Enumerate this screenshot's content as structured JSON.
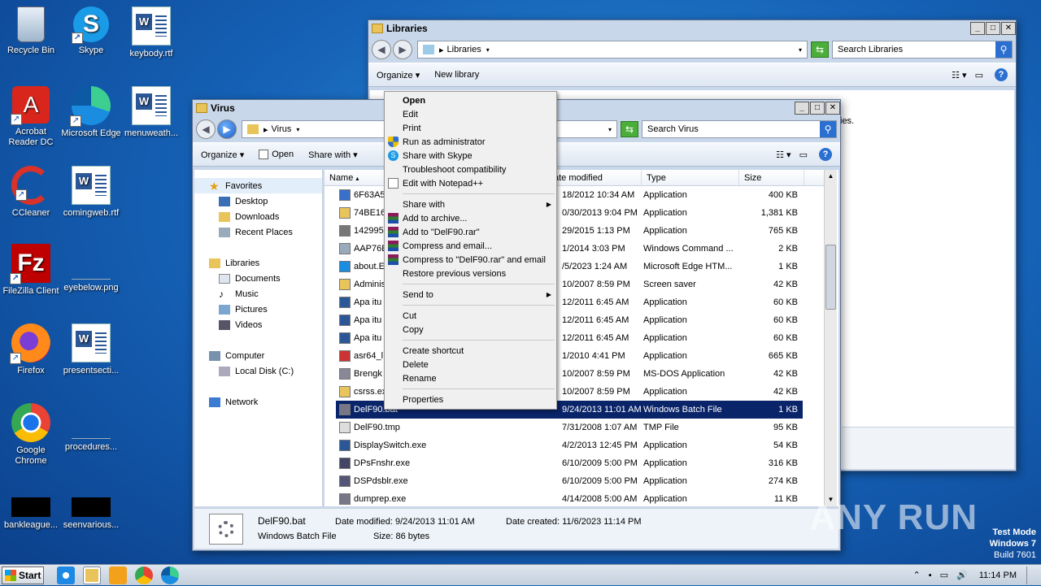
{
  "desktop_icons": [
    {
      "label": "Recycle Bin"
    },
    {
      "label": "Skype"
    },
    {
      "label": "keybody.rtf"
    },
    {
      "label": "Acrobat Reader DC"
    },
    {
      "label": "Microsoft Edge"
    },
    {
      "label": "menuweath..."
    },
    {
      "label": "CCleaner"
    },
    {
      "label": "comingweb.rtf"
    },
    {
      "label": "FileZilla Client"
    },
    {
      "label": "eyebelow.png"
    },
    {
      "label": "Firefox"
    },
    {
      "label": "presentsecti..."
    },
    {
      "label": "Google Chrome"
    },
    {
      "label": "procedures..."
    },
    {
      "label": "bankleague..."
    },
    {
      "label": "seenvarious..."
    }
  ],
  "libraries_window": {
    "title": "Libraries",
    "address": "Libraries",
    "search_placeholder": "Search Libraries",
    "toolbar": {
      "organize": "Organize",
      "new_library": "New library"
    },
    "body_fragment": "ies."
  },
  "virus_window": {
    "title": "Virus",
    "address": "Virus",
    "search_placeholder": "Search Virus",
    "toolbar": {
      "organize": "Organize",
      "open": "Open",
      "share_with": "Share with"
    },
    "nav": {
      "favorites": "Favorites",
      "desktop": "Desktop",
      "downloads": "Downloads",
      "recent": "Recent Places",
      "libraries": "Libraries",
      "documents": "Documents",
      "music": "Music",
      "pictures": "Pictures",
      "videos": "Videos",
      "computer": "Computer",
      "local_disk": "Local Disk (C:)",
      "network": "Network"
    },
    "columns": {
      "name": "Name",
      "date": "ate modified",
      "type": "Type",
      "size": "Size"
    },
    "rows": [
      {
        "name": "6F63A5",
        "date": "18/2012 10:34 AM",
        "type": "Application",
        "size": "400 KB"
      },
      {
        "name": "74BE16",
        "date": "0/30/2013 9:04 PM",
        "type": "Application",
        "size": "1,381 KB"
      },
      {
        "name": "142995",
        "date": "29/2015 1:13 PM",
        "type": "Application",
        "size": "765 KB"
      },
      {
        "name": "AAP76E",
        "date": "1/2014 3:03 PM",
        "type": "Windows Command ...",
        "size": "2 KB"
      },
      {
        "name": "about.E",
        "date": "/5/2023 1:24 AM",
        "type": "Microsoft Edge HTM...",
        "size": "1 KB"
      },
      {
        "name": "Adminis",
        "date": "10/2007 8:59 PM",
        "type": "Screen saver",
        "size": "42 KB"
      },
      {
        "name": "Apa itu",
        "date": "12/2011 6:45 AM",
        "type": "Application",
        "size": "60 KB"
      },
      {
        "name": "Apa itu",
        "date": "12/2011 6:45 AM",
        "type": "Application",
        "size": "60 KB"
      },
      {
        "name": "Apa itu",
        "date": "12/2011 6:45 AM",
        "type": "Application",
        "size": "60 KB"
      },
      {
        "name": "asr64_l",
        "date": "1/2010 4:41 PM",
        "type": "Application",
        "size": "665 KB"
      },
      {
        "name": "Brengk",
        "date": "10/2007 8:59 PM",
        "type": "MS-DOS Application",
        "size": "42 KB"
      },
      {
        "name": "csrss.ex",
        "date": "10/2007 8:59 PM",
        "type": "Application",
        "size": "42 KB"
      },
      {
        "name": "DelF90.bat",
        "date": "9/24/2013 11:01 AM",
        "type": "Windows Batch File",
        "size": "1 KB",
        "selected": true
      },
      {
        "name": "DelF90.tmp",
        "date": "7/31/2008 1:07 AM",
        "type": "TMP File",
        "size": "95 KB"
      },
      {
        "name": "DisplaySwitch.exe",
        "date": "4/2/2013 12:45 PM",
        "type": "Application",
        "size": "54 KB"
      },
      {
        "name": "DPsFnshr.exe",
        "date": "6/10/2009 5:00 PM",
        "type": "Application",
        "size": "316 KB"
      },
      {
        "name": "DSPdsblr.exe",
        "date": "6/10/2009 5:00 PM",
        "type": "Application",
        "size": "274 KB"
      },
      {
        "name": "dumprep.exe",
        "date": "4/14/2008 5:00 AM",
        "type": "Application",
        "size": "11 KB"
      }
    ],
    "details": {
      "filename": "DelF90.bat",
      "filetype": "Windows Batch File",
      "date_modified": "Date modified: 9/24/2013 11:01 AM",
      "date_created": "Date created: 11/6/2023 11:14 PM",
      "size": "Size: 86 bytes"
    }
  },
  "context_menu": {
    "items_1": [
      "Open",
      "Edit",
      "Print",
      "Run as administrator",
      "Share with Skype",
      "Troubleshoot compatibility",
      "Edit with Notepad++"
    ],
    "items_2": [
      "Share with",
      "Add to archive...",
      "Add to \"DelF90.rar\"",
      "Compress and email...",
      "Compress to \"DelF90.rar\" and email",
      "Restore previous versions"
    ],
    "items_3": [
      "Send to"
    ],
    "items_4": [
      "Cut",
      "Copy"
    ],
    "items_5": [
      "Create shortcut",
      "Delete",
      "Rename"
    ],
    "items_6": [
      "Properties"
    ]
  },
  "taskbar": {
    "start": "Start",
    "clock": "11:14 PM"
  },
  "watermark": "ANY RUN",
  "test_mode": {
    "line1": "Test Mode",
    "line2": "Windows 7",
    "line3": "Build 7601"
  }
}
